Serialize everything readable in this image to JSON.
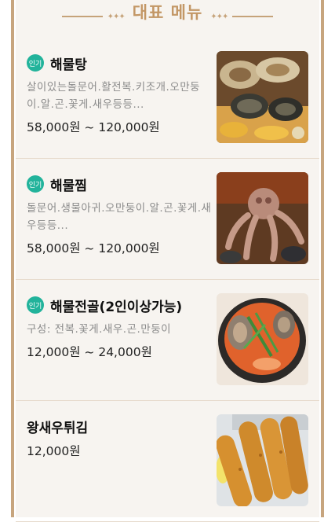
{
  "section_title": "대표 메뉴",
  "header_dots": "✦✦✦",
  "menu_items": [
    {
      "badge": "인기",
      "name": "해물탕",
      "description": "살이있는돌문어.활전복.키조개.오만둥이.알.곤.꽃게.새우등등...",
      "price": "58,000원 ~ 120,000원",
      "image_icon": "seafood-stew-photo"
    },
    {
      "badge": "인기",
      "name": "해물찜",
      "description": "돌문어.생물아귀.오만둥이.알.곤.꽃게.새우등등...",
      "price": "58,000원 ~ 120,000원",
      "image_icon": "braised-seafood-photo"
    },
    {
      "badge": "인기",
      "name": "해물전골(2인이상가능)",
      "description": "구성: 전복.꽃게.새우.곤.만둥이",
      "price": "12,000원 ~ 24,000원",
      "image_icon": "seafood-hotpot-photo"
    },
    {
      "badge": "",
      "name": "왕새우튀김",
      "description": "",
      "price": "12,000원",
      "image_icon": "fried-shrimp-photo"
    }
  ],
  "colors": {
    "accent_gold": "#c39766",
    "badge_teal": "#22b39b",
    "panel_bg": "#f7f4f0"
  }
}
